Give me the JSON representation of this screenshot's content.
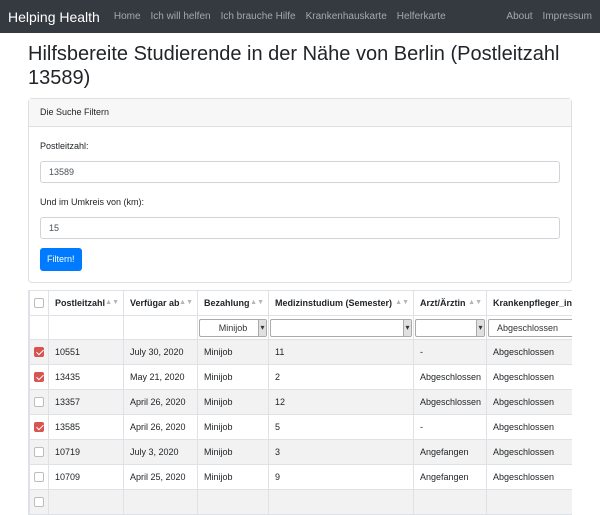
{
  "nav": {
    "brand": "Helping Health",
    "links": [
      "Home",
      "Ich will helfen",
      "Ich brauche Hilfe",
      "Krankenhauskarte",
      "Helferkarte"
    ],
    "right_links": [
      "About",
      "Impressum"
    ]
  },
  "page": {
    "title": "Hilfsbereite Studierende in der Nähe von Berlin (Postleitzahl 13589)"
  },
  "filter": {
    "header": "Die Suche Filtern",
    "plz_label": "Postleitzahl:",
    "plz_value": "13589",
    "radius_label": "Und im Umkreis von (km):",
    "radius_value": "15",
    "button": "Filtern!"
  },
  "table": {
    "columns": [
      "Postleitzahl",
      "Verfügar ab",
      "Bezahlung",
      "Medizinstudium (Semester)",
      "Arzt/Ärztin",
      "Krankenpfleger_in"
    ],
    "filters": {
      "bezahlung": "Minijob",
      "pfleger": "Abgeschlossen"
    },
    "rows": [
      {
        "checked": true,
        "plz": "10551",
        "date": "July 30, 2020",
        "pay": "Minijob",
        "sem": "11",
        "arzt": "-",
        "pfleger": "Abgeschlossen"
      },
      {
        "checked": true,
        "plz": "13435",
        "date": "May 21, 2020",
        "pay": "Minijob",
        "sem": "2",
        "arzt": "Abgeschlossen",
        "pfleger": "Abgeschlossen"
      },
      {
        "checked": false,
        "plz": "13357",
        "date": "April 26, 2020",
        "pay": "Minijob",
        "sem": "12",
        "arzt": "Abgeschlossen",
        "pfleger": "Abgeschlossen"
      },
      {
        "checked": true,
        "plz": "13585",
        "date": "April 26, 2020",
        "pay": "Minijob",
        "sem": "5",
        "arzt": "-",
        "pfleger": "Abgeschlossen"
      },
      {
        "checked": false,
        "plz": "10719",
        "date": "July 3, 2020",
        "pay": "Minijob",
        "sem": "3",
        "arzt": "Angefangen",
        "pfleger": "Abgeschlossen"
      },
      {
        "checked": false,
        "plz": "10709",
        "date": "April 25, 2020",
        "pay": "Minijob",
        "sem": "9",
        "arzt": "Angefangen",
        "pfleger": "Abgeschlossen"
      },
      {
        "checked": false,
        "plz": "",
        "date": "",
        "pay": "",
        "sem": "",
        "arzt": "",
        "pfleger": ""
      }
    ]
  }
}
